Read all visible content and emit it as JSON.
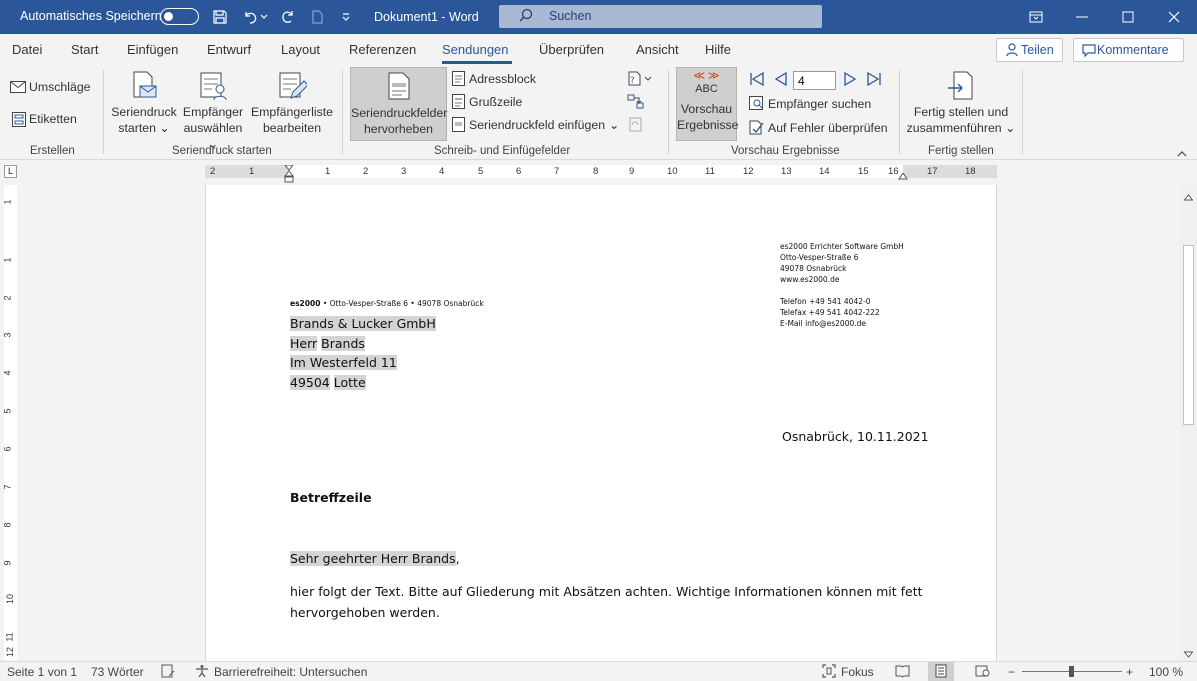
{
  "titlebar": {
    "autosave_label": "Automatisches Speichern",
    "doc_title": "Dokument1  -  Word",
    "search_placeholder": "Suchen"
  },
  "tabs": {
    "items": [
      "Datei",
      "Start",
      "Einfügen",
      "Entwurf",
      "Layout",
      "Referenzen",
      "Sendungen",
      "Überprüfen",
      "Ansicht",
      "Hilfe"
    ],
    "active": "Sendungen",
    "share_label": "Teilen",
    "comments_label": "Kommentare"
  },
  "ribbon": {
    "create": {
      "envelopes": "Umschläge",
      "labels": "Etiketten",
      "group": "Erstellen"
    },
    "start_mail_merge": {
      "start_l1": "Seriendruck",
      "start_l2": "starten",
      "select_l1": "Empfänger",
      "select_l2": "auswählen",
      "edit_l1": "Empfängerliste",
      "edit_l2": "bearbeiten",
      "group": "Seriendruck starten"
    },
    "write_insert": {
      "highlight_l1": "Seriendruckfelder",
      "highlight_l2": "hervorheben",
      "address_block": "Adressblock",
      "greeting_line": "Grußzeile",
      "insert_field": "Seriendruckfeld einfügen",
      "group": "Schreib- und Einfügefelder"
    },
    "preview": {
      "abc_text": "ABC",
      "preview_l1": "Vorschau",
      "preview_l2": "Ergebnisse",
      "record": "4",
      "find_recipient": "Empfänger suchen",
      "check_errors": "Auf Fehler überprüfen",
      "group": "Vorschau Ergebnisse"
    },
    "finish": {
      "finish_l1": "Fertig stellen und",
      "finish_l2": "zusammenführen",
      "group": "Fertig stellen"
    }
  },
  "ruler": {
    "corner": "L",
    "h_numbers": [
      "2",
      "1",
      "1",
      "2",
      "3",
      "4",
      "5",
      "6",
      "7",
      "8",
      "9",
      "10",
      "11",
      "12",
      "13",
      "14",
      "15",
      "16",
      "17",
      "18"
    ],
    "v_numbers": [
      "1",
      "1",
      "2",
      "3",
      "4",
      "5",
      "6",
      "7",
      "8",
      "9",
      "10",
      "11",
      "12"
    ]
  },
  "document": {
    "sender_company": "es2000 Errichter Software GmbH",
    "sender_street": "Otto-Vesper-Straße 6",
    "sender_city": "49078 Osnabrück",
    "sender_web": "www.es2000.de",
    "sender_phone": "Telefon +49 541 4042-0",
    "sender_fax": "Telefax +49 541 4042-222",
    "sender_email": "E-Mail info@es2000.de",
    "return_brand": "es2000",
    "return_rest": " • Otto-Vesper-Straße 6 • 49078 Osnabrück",
    "addr_company": "Brands & Lucker GmbH",
    "addr_salutation": "Herr",
    "addr_name": "Brands",
    "addr_street": "Im Westerfeld 11",
    "addr_zip": "49504",
    "addr_city": "Lotte",
    "date_line": "Osnabrück, 10.11.2021",
    "subject": "Betreffzeile",
    "greeting": "Sehr geehrter Herr Brands",
    "greeting_comma": ",",
    "body_line1": "hier folgt der Text. Bitte auf Gliederung mit Absätzen achten. Wichtige Informationen können mit fett",
    "body_line2": "hervorgehoben werden."
  },
  "status": {
    "page": "Seite 1 von 1",
    "words": "73 Wörter",
    "accessibility": "Barrierefreiheit: Untersuchen",
    "focus": "Fokus",
    "zoom_minus": "−",
    "zoom_plus": "+",
    "zoom": "100 %"
  }
}
